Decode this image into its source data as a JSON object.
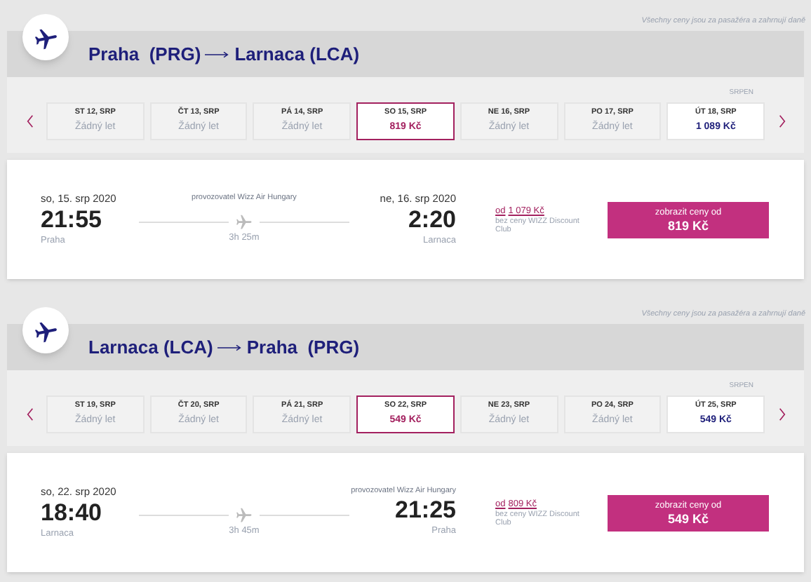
{
  "sections": [
    {
      "note": "Všechny ceny jsou za pasažéra a zahrnují daně",
      "origin": "Praha  (PRG)",
      "destination": "Larnaca (LCA)",
      "month": "SRPEN",
      "days": [
        {
          "label": "ST 12, SRP",
          "text": "Žádný let",
          "available": false,
          "selected": false
        },
        {
          "label": "ČT 13, SRP",
          "text": "Žádný let",
          "available": false,
          "selected": false
        },
        {
          "label": "PÁ 14, SRP",
          "text": "Žádný let",
          "available": false,
          "selected": false
        },
        {
          "label": "SO 15, SRP",
          "text": "819 Kč",
          "available": true,
          "selected": true
        },
        {
          "label": "NE 16, SRP",
          "text": "Žádný let",
          "available": false,
          "selected": false
        },
        {
          "label": "PO 17, SRP",
          "text": "Žádný let",
          "available": false,
          "selected": false
        },
        {
          "label": "ÚT 18, SRP",
          "text": "1 089 Kč",
          "available": true,
          "selected": false
        }
      ],
      "flight": {
        "departure_date": "so, 15. srp 2020",
        "departure_time": "21:55",
        "departure_city": "Praha",
        "operator": "provozovatel Wizz Air Hungary",
        "duration": "3h 25m",
        "arrival_date": "ne, 16. srp 2020",
        "arrival_time": "2:20",
        "arrival_city": "Larnaca",
        "from_word": "od",
        "from_price": "1 079 Kč",
        "club_note": "bez ceny WIZZ Discount Club",
        "button_label": "zobrazit ceny od",
        "button_price": "819 Kč"
      }
    },
    {
      "note": "Všechny ceny jsou za pasažéra a zahrnují daně",
      "origin": "Larnaca (LCA)",
      "destination": "Praha  (PRG)",
      "month": "SRPEN",
      "days": [
        {
          "label": "ST 19, SRP",
          "text": "Žádný let",
          "available": false,
          "selected": false
        },
        {
          "label": "ČT 20, SRP",
          "text": "Žádný let",
          "available": false,
          "selected": false
        },
        {
          "label": "PÁ 21, SRP",
          "text": "Žádný let",
          "available": false,
          "selected": false
        },
        {
          "label": "SO 22, SRP",
          "text": "549 Kč",
          "available": true,
          "selected": true
        },
        {
          "label": "NE 23, SRP",
          "text": "Žádný let",
          "available": false,
          "selected": false
        },
        {
          "label": "PO 24, SRP",
          "text": "Žádný let",
          "available": false,
          "selected": false
        },
        {
          "label": "ÚT 25, SRP",
          "text": "549 Kč",
          "available": true,
          "selected": false
        }
      ],
      "flight": {
        "departure_date": "so, 22. srp 2020",
        "departure_time": "18:40",
        "departure_city": "Larnaca",
        "duration": "3h 45m",
        "arrival_operator": "provozovatel Wizz Air Hungary",
        "arrival_time": "21:25",
        "arrival_city": "Praha",
        "from_word": "od",
        "from_price": "809 Kč",
        "club_note": "bez ceny WIZZ Discount Club",
        "button_label": "zobrazit ceny od",
        "button_price": "549 Kč"
      }
    }
  ]
}
